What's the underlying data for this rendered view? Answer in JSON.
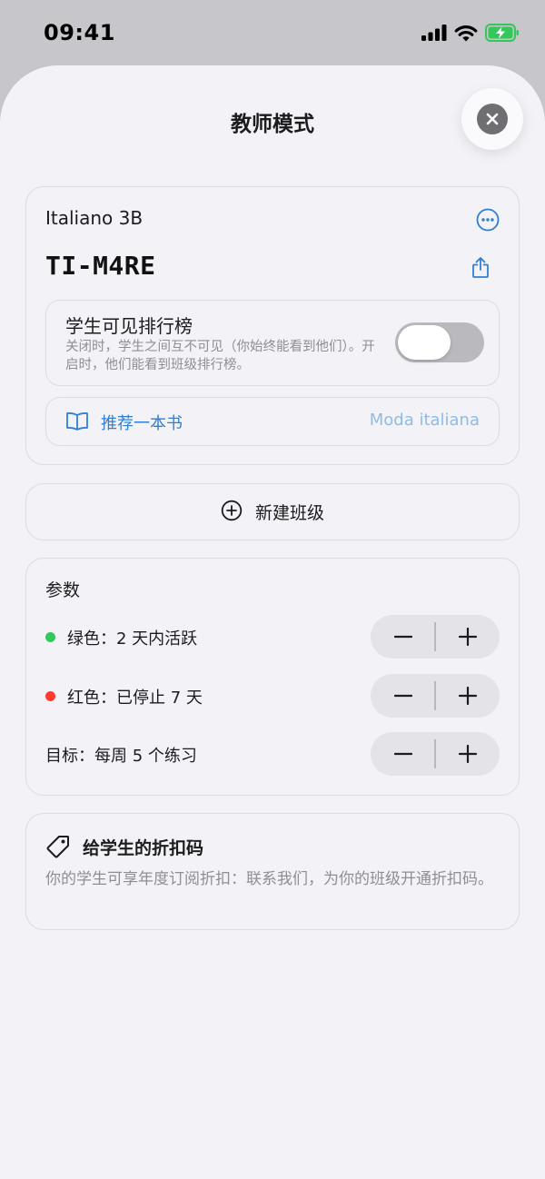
{
  "status_bar": {
    "time": "09:41"
  },
  "sheet": {
    "title": "教师模式"
  },
  "class_card": {
    "name": "Italiano 3B",
    "code": "TI-M4RE",
    "leaderboard": {
      "title": "学生可见排行榜",
      "description": "关闭时，学生之间互不可见（你始终能看到他们）。开启时，他们能看到班级排行榜。",
      "enabled": false
    },
    "recommend_book": {
      "label": "推荐一本书",
      "value": "Moda italiana"
    }
  },
  "new_class": {
    "label": "新建班级"
  },
  "params": {
    "title": "参数",
    "rows": [
      {
        "label": "绿色：2 天内活跃",
        "dot_color": "#34c759"
      },
      {
        "label": "红色：已停止 7 天",
        "dot_color": "#ff3b30"
      },
      {
        "label": "目标：每周 5 个练习"
      }
    ]
  },
  "discount": {
    "title": "给学生的折扣码",
    "description": "你的学生可享年度订阅折扣：联系我们，为你的班级开通折扣码。"
  },
  "colors": {
    "accent": "#2f7fd6",
    "accent_muted": "#8fbbe8",
    "green": "#34c759",
    "red": "#ff3b30"
  }
}
